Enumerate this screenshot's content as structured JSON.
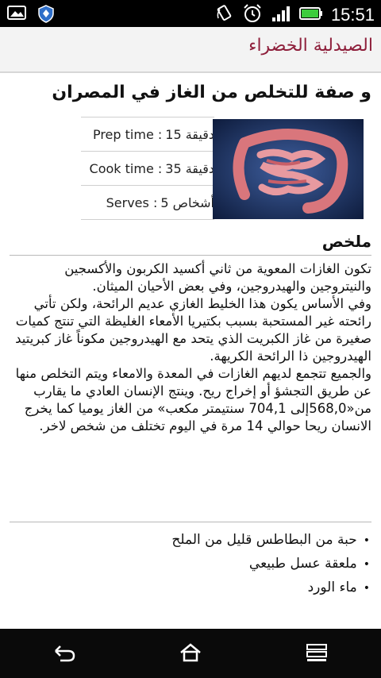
{
  "status_bar": {
    "time": "15:51",
    "left_icons": [
      "image-icon",
      "shield-icon"
    ],
    "right_icons": [
      "rotate-icon",
      "alarm-icon",
      "signal-icon",
      "battery-icon"
    ]
  },
  "app": {
    "title": "الصيدلية الخضراء"
  },
  "recipe": {
    "title": "و صفة للتخلص من الغاز في المصران",
    "prep": {
      "label": "Prep time :",
      "value": "15 دقيقة"
    },
    "cook": {
      "label": "Cook time :",
      "value": "35 دقيقة"
    },
    "serves": {
      "label": "Serves :",
      "value": "5 أشخاص"
    },
    "summary_heading": "ملخص",
    "summary_text": "تكون الغازات المعوية من ثاني أكسيد الكربون والأكسجين والنيتروجين والهيدروجين، وفي بعض الأحيان الميثان.\nوفي الأساس يكون هذا الخليط الغازي عديم الرائحة، ولكن تأتي رائحته غير المستحبة بسبب بكتيريا الأمعاء الغليظة التي تنتج كميات صغيرة من غاز الكبريت الذي يتحد مع الهيدروجين مكوناً غاز كبريتيد الهيدروجين ذا الرائحة الكريهة.\nوالجميع تتجمع لديهم الغازات في المعدة والامعاء ويتم التخلص منها عن طريق التجشؤ أو إخراج ريح. وينتج الإنسان العادي ما يقارب من«568,0إلى 704,1 سنتيمتر مكعب» من الغاز يوميا كما يخرج الانسان ريحا حوالي 14 مرة في اليوم تختلف من شخص لاخر.",
    "ingredients": [
      "حبة من البطاطس قليل من الملح",
      "ملعقة عسل طبيعي",
      "ماء الورد"
    ]
  },
  "navbar": {
    "buttons": [
      "back-icon",
      "home-icon",
      "recent-apps-icon"
    ]
  }
}
